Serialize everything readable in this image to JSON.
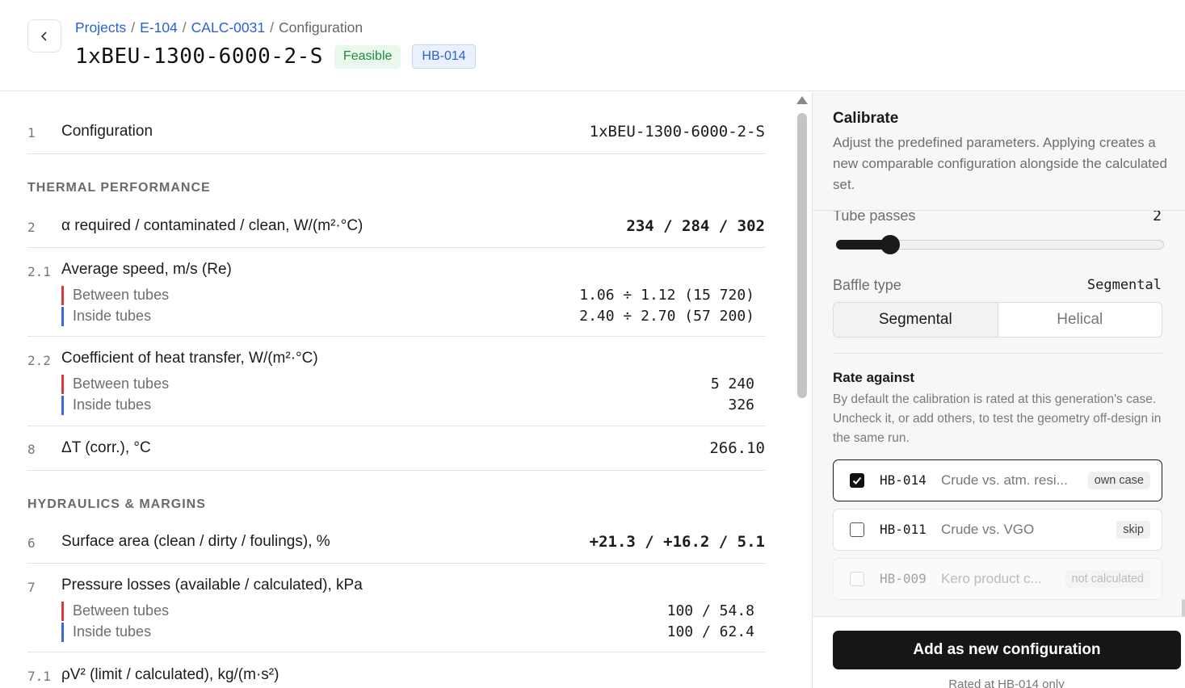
{
  "header": {
    "breadcrumb": [
      "Projects",
      "E-104",
      "CALC-0031",
      "Configuration"
    ],
    "breadcrumb_sep": "/",
    "title": "1xBEU-1300-6000-2-S",
    "status_badge": "Feasible",
    "case_badge": "HB-014"
  },
  "rows": {
    "config": {
      "num": "1",
      "label": "Configuration",
      "value": "1xBEU-1300-6000-2-S"
    },
    "thermal_section": "THERMAL PERFORMANCE",
    "alpha": {
      "num": "2",
      "label": "α required / contaminated / clean, W/(m²·°C)",
      "value": "234 / 284 / 302"
    },
    "speed": {
      "num": "2.1",
      "label": "Average speed, m/s (Re)",
      "between_label": "Between tubes",
      "between_value": "1.06 ÷ 1.12 (15 720)",
      "inside_label": "Inside tubes",
      "inside_value": "2.40 ÷ 2.70 (57 200)"
    },
    "coef": {
      "num": "2.2",
      "label": "Coefficient of heat transfer, W/(m²·°C)",
      "between_label": "Between tubes",
      "between_value": "5 240",
      "inside_label": "Inside tubes",
      "inside_value": "326"
    },
    "dt": {
      "num": "8",
      "label": "ΔT (corr.), °C",
      "value": "266.10"
    },
    "hydraulics_section": "HYDRAULICS & MARGINS",
    "surface": {
      "num": "6",
      "label": "Surface area (clean / dirty / foulings), %",
      "value": "+21.3 / +16.2 / 5.1"
    },
    "pressure": {
      "num": "7",
      "label": "Pressure losses (available / calculated), kPa",
      "between_label": "Between tubes",
      "between_value": "100 / 54.8",
      "inside_label": "Inside tubes",
      "inside_value": "100 / 62.4"
    },
    "rhov": {
      "num": "7.1",
      "label": "ρV² (limit / calculated), kg/(m·s²)"
    }
  },
  "calibrate": {
    "title": "Calibrate",
    "description": "Adjust the predefined parameters. Applying creates a new comparable configuration alongside the calculated set.",
    "tube_passes_label": "Tube passes",
    "tube_passes_value": "2",
    "tube_passes_fraction": 0.16,
    "baffle_type_label": "Baffle type",
    "baffle_type_value": "Segmental",
    "baffle_options": [
      "Segmental",
      "Helical"
    ],
    "rate_against_title": "Rate against",
    "rate_against_desc": "By default the calibration is rated at this generation's case. Uncheck it, or add others, to test the geometry off-design in the same run.",
    "cases": [
      {
        "id": "HB-014",
        "name": "Crude vs. atm. resi...",
        "tag": "own case",
        "checked": true
      },
      {
        "id": "HB-011",
        "name": "Crude vs. VGO",
        "tag": "skip",
        "checked": false
      },
      {
        "id": "HB-009",
        "name": "Kero product c...",
        "tag": "not calculated",
        "checked": false
      }
    ],
    "add_button": "Add as new configuration",
    "footnote": "Rated at HB-014 only"
  }
}
